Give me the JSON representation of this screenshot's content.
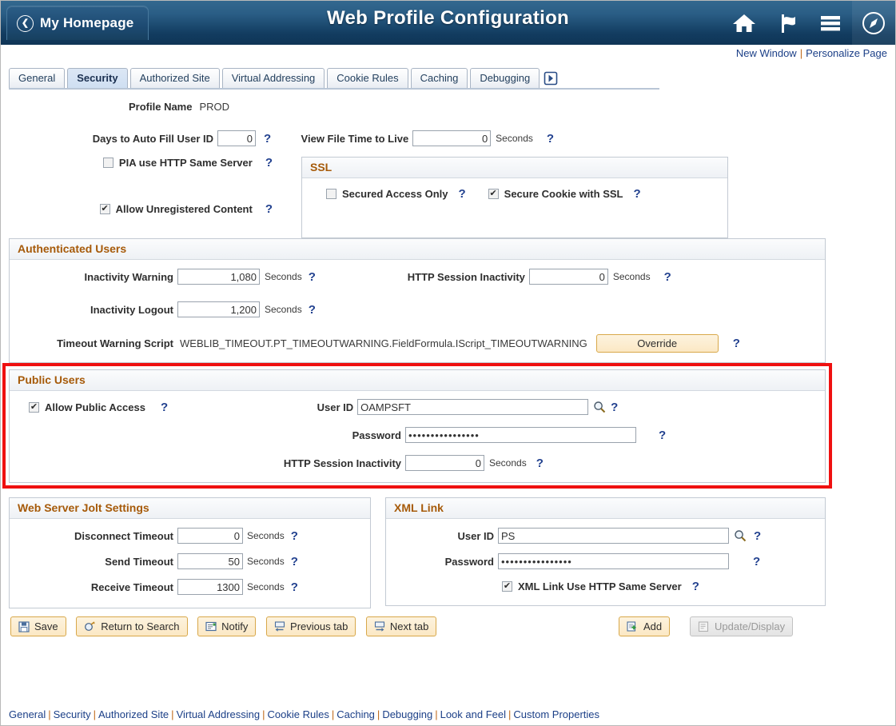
{
  "header": {
    "home_button": "My Homepage",
    "title": "Web Profile Configuration",
    "icons": [
      "home-icon",
      "flag-icon",
      "hamburger-menu-icon",
      "navbar-compass-icon"
    ]
  },
  "linkbar": {
    "new_window": "New Window",
    "separator": "|",
    "personalize_page": "Personalize Page"
  },
  "tabs": [
    {
      "label": "General",
      "active": false
    },
    {
      "label": "Security",
      "active": true
    },
    {
      "label": "Authorized Site",
      "active": false
    },
    {
      "label": "Virtual Addressing",
      "active": false
    },
    {
      "label": "Cookie Rules",
      "active": false
    },
    {
      "label": "Caching",
      "active": false
    },
    {
      "label": "Debugging",
      "active": false
    }
  ],
  "profile": {
    "name_label": "Profile Name",
    "name_value": "PROD"
  },
  "top": {
    "days_auto_fill_label": "Days to Auto Fill User ID",
    "days_auto_fill_value": "0",
    "pia_same_server_label": "PIA use HTTP Same Server",
    "pia_same_server_checked": false,
    "allow_unregistered_label": "Allow Unregistered Content",
    "allow_unregistered_checked": true,
    "view_file_ttl_label": "View File Time to Live",
    "view_file_ttl_value": "0",
    "seconds": "Seconds",
    "help": "?"
  },
  "ssl": {
    "title": "SSL",
    "secured_access_label": "Secured Access Only",
    "secured_access_checked": false,
    "secure_cookie_label": "Secure Cookie with SSL",
    "secure_cookie_checked": true
  },
  "authenticated_users": {
    "title": "Authenticated Users",
    "inactivity_warning_label": "Inactivity Warning",
    "inactivity_warning_value": "1,080",
    "inactivity_logout_label": "Inactivity Logout",
    "inactivity_logout_value": "1,200",
    "http_session_inactivity_label": "HTTP Session Inactivity",
    "http_session_inactivity_value": "0",
    "timeout_script_label": "Timeout Warning Script",
    "timeout_script_value": "WEBLIB_TIMEOUT.PT_TIMEOUTWARNING.FieldFormula.IScript_TIMEOUTWARNING",
    "override_button": "Override",
    "seconds": "Seconds"
  },
  "public_users": {
    "title": "Public Users",
    "allow_public_access_label": "Allow Public Access",
    "allow_public_access_checked": true,
    "user_id_label": "User ID",
    "user_id_value": "OAMPSFT",
    "password_label": "Password",
    "password_value": "••••••••••••••••",
    "http_session_inactivity_label": "HTTP Session Inactivity",
    "http_session_inactivity_value": "0",
    "seconds": "Seconds",
    "highlight_color": "#ef1010"
  },
  "jolt": {
    "title": "Web Server Jolt Settings",
    "disconnect_timeout_label": "Disconnect Timeout",
    "disconnect_timeout_value": "0",
    "send_timeout_label": "Send Timeout",
    "send_timeout_value": "50",
    "receive_timeout_label": "Receive Timeout",
    "receive_timeout_value": "1300",
    "seconds": "Seconds"
  },
  "xml_link": {
    "title": "XML Link",
    "user_id_label": "User ID",
    "user_id_value": "PS",
    "password_label": "Password",
    "password_value": "••••••••••••••••",
    "same_server_label": "XML Link Use HTTP Same Server",
    "same_server_checked": true
  },
  "toolbar": {
    "save": "Save",
    "return_to_search": "Return to Search",
    "notify": "Notify",
    "previous_tab": "Previous tab",
    "next_tab": "Next tab",
    "add": "Add",
    "update_display": "Update/Display"
  },
  "bottom_links": [
    "General",
    "Security",
    "Authorized Site",
    "Virtual Addressing",
    "Cookie Rules",
    "Caching",
    "Debugging",
    "Look and Feel",
    "Custom Properties"
  ]
}
